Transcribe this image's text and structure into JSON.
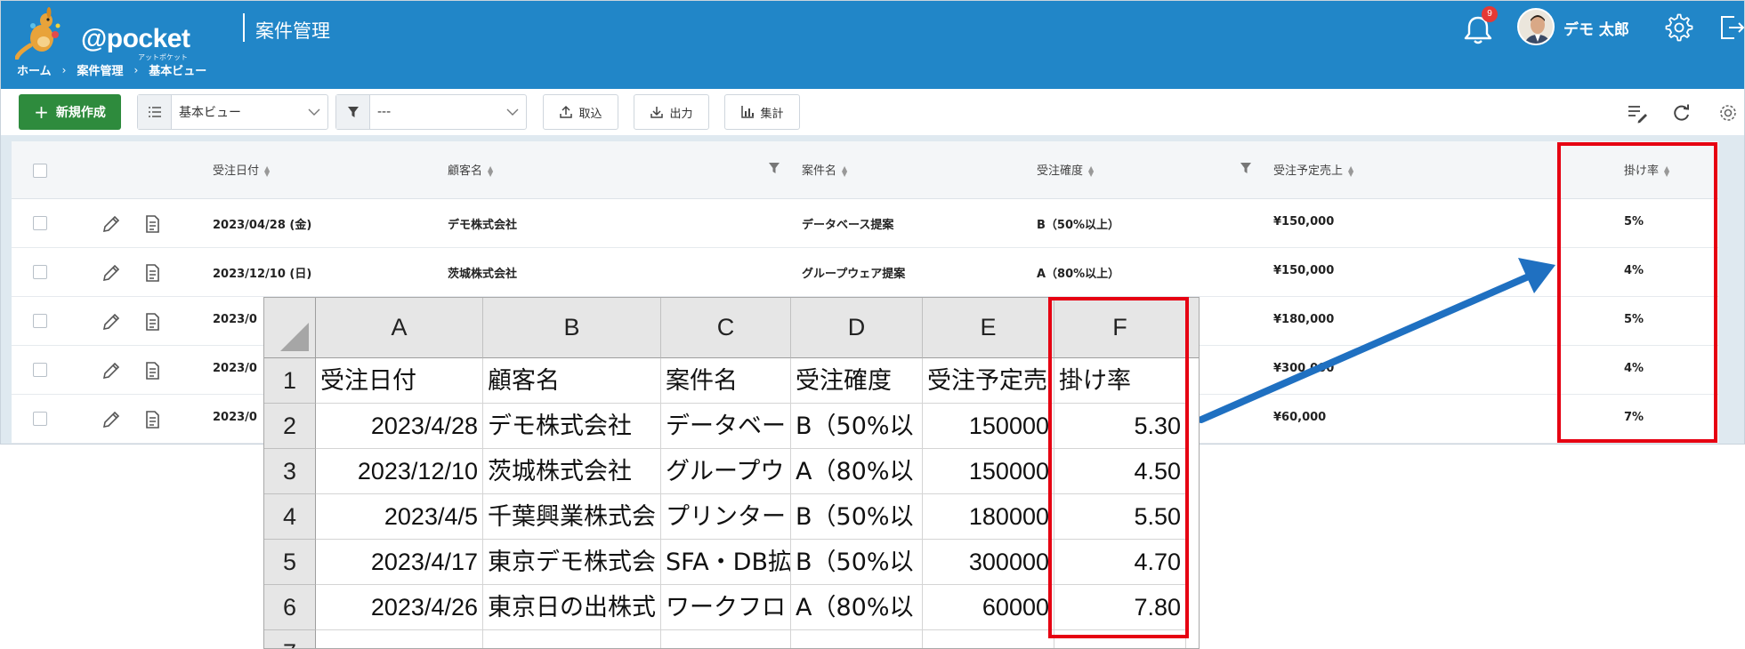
{
  "header": {
    "logo_text": "@pocket",
    "logo_sub": "アットポケット",
    "title": "案件管理",
    "notification_count": "9",
    "user_name": "デモ 太郎"
  },
  "breadcrumb": [
    "ホーム",
    "案件管理",
    "基本ビュー"
  ],
  "toolbar": {
    "new_label": "新規作成",
    "view_select": "基本ビュー",
    "filter_select": "---",
    "import_label": "取込",
    "export_label": "出力",
    "aggregate_label": "集計"
  },
  "grid": {
    "columns": [
      "受注日付",
      "顧客名",
      "案件名",
      "受注確度",
      "受注予定売上",
      "掛け率"
    ],
    "rows": [
      {
        "date": "2023/04/28 (金)",
        "customer": "デモ株式会社",
        "project": "データベース提案",
        "probability": "B（50%以上）",
        "sales": "¥150,000",
        "rate": "5%"
      },
      {
        "date": "2023/12/10 (日)",
        "customer": "茨城株式会社",
        "project": "グループウェア提案",
        "probability": "A（80%以上）",
        "sales": "¥150,000",
        "rate": "4%"
      },
      {
        "date": "2023/0",
        "customer": "",
        "project": "",
        "probability": "",
        "sales": "¥180,000",
        "rate": "5%"
      },
      {
        "date": "2023/0",
        "customer": "",
        "project": "",
        "probability": "",
        "sales": "¥300,000",
        "rate": "4%"
      },
      {
        "date": "2023/0",
        "customer": "",
        "project": "",
        "probability": "",
        "sales": "¥60,000",
        "rate": "7%"
      }
    ]
  },
  "excel": {
    "col_letters": [
      "A",
      "B",
      "C",
      "D",
      "E",
      "F"
    ],
    "row_numbers": [
      "1",
      "2",
      "3",
      "4",
      "5",
      "6",
      "7"
    ],
    "header_row": [
      "受注日付",
      "顧客名",
      "案件名",
      "受注確度",
      "受注予定売",
      "掛け率"
    ],
    "rows": [
      [
        "2023/4/28",
        "デモ株式会社",
        "データベー",
        "B（50%以",
        "150000",
        "5.30"
      ],
      [
        "2023/12/10",
        "茨城株式会社",
        "グループウ",
        "A（80%以",
        "150000",
        "4.50"
      ],
      [
        "2023/4/5",
        "千葉興業株式会",
        "プリンター",
        "B（50%以",
        "180000",
        "5.50"
      ],
      [
        "2023/4/17",
        "東京デモ株式会",
        "SFA・DB拡",
        "B（50%以",
        "300000",
        "4.70"
      ],
      [
        "2023/4/26",
        "東京日の出株式",
        "ワークフロ",
        "A（80%以",
        "60000",
        "7.80"
      ]
    ]
  },
  "colors": {
    "header_blue": "#2186c8",
    "new_button_green": "#2e8b3d",
    "highlight_red": "#e60012",
    "arrow_blue": "#1f70c1"
  }
}
